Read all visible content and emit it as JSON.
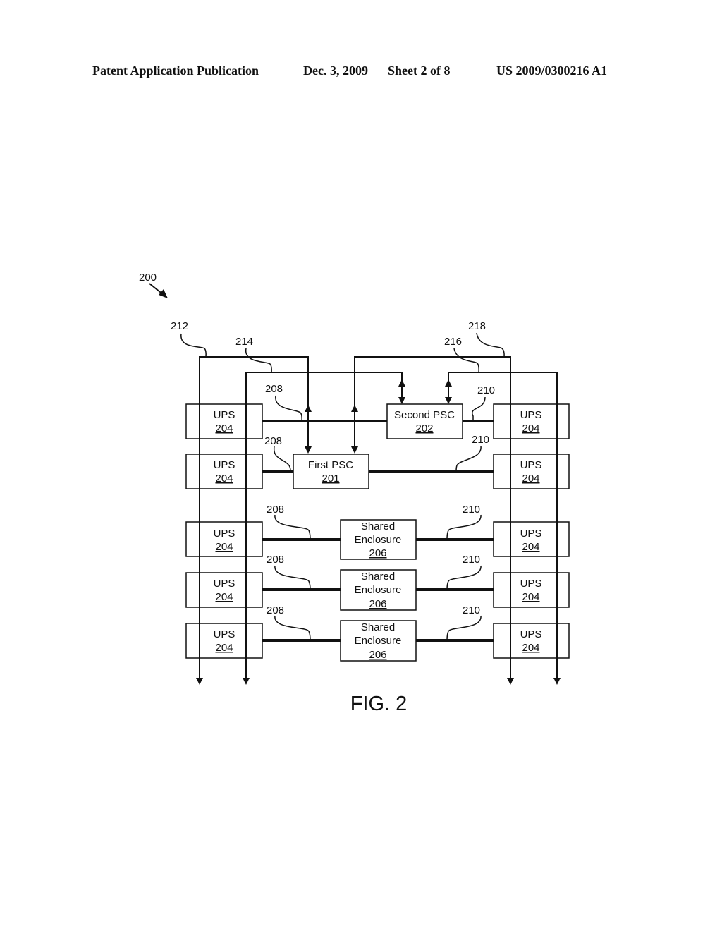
{
  "header": {
    "publication": "Patent Application Publication",
    "date": "Dec. 3, 2009",
    "sheet": "Sheet 2 of 8",
    "number": "US 2009/0300216 A1"
  },
  "figure": {
    "ref": "200",
    "caption": "FIG. 2",
    "first_psc": {
      "name": "First PSC",
      "ref": "201"
    },
    "second_psc": {
      "name": "Second PSC",
      "ref": "202"
    },
    "ups": {
      "name": "UPS",
      "ref": "204"
    },
    "enclosure": {
      "name_line1": "Shared",
      "name_line2": "Enclosure",
      "ref": "206"
    },
    "labels": {
      "left_link": "208",
      "right_link": "210",
      "bus_a": "212",
      "bus_b": "214",
      "bus_c": "216",
      "bus_d": "218"
    }
  }
}
